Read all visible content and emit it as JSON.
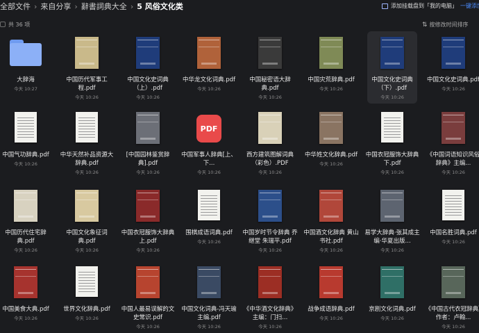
{
  "breadcrumb": {
    "items": [
      "全部文件",
      "来自分享",
      "辭書詞典大全"
    ],
    "current": "5 风俗文化类"
  },
  "promo": {
    "text": "添加挂载盘到「我的电脑」",
    "link": "一键添加",
    "icon": "drive-icon"
  },
  "toolbar": {
    "count_label": "共 36 项",
    "sort_label": "按修改时间排序",
    "sort_icon": "sort-icon"
  },
  "files": [
    {
      "name": "大辞海",
      "date": "今天 10:27",
      "kind": "folder",
      "color": "#8cb0f7"
    },
    {
      "name": "中国历代军事工程.pdf",
      "date": "今天 10:26",
      "kind": "book",
      "color": "#c9b98a"
    },
    {
      "name": "中国文化史词典（上）.pdf",
      "date": "今天 10:26",
      "kind": "book",
      "color": "#1f3c7a"
    },
    {
      "name": "中华龙文化词典.pdf",
      "date": "今天 10:26",
      "kind": "book",
      "color": "#b0623a"
    },
    {
      "name": "中国秘密语大辞典.pdf",
      "date": "今天 10:26",
      "kind": "book",
      "color": "#3a3a3a"
    },
    {
      "name": "中国灾荒辞典.pdf",
      "date": "今天 10:26",
      "kind": "book",
      "color": "#7f8a56"
    },
    {
      "name": "中国文化史词典（下）.pdf",
      "date": "今天 10:26",
      "kind": "book",
      "color": "#1f3c7a",
      "selected": true
    },
    {
      "name": "中国文化史词典.pdf",
      "date": "今天 10:26",
      "kind": "book",
      "color": "#1f3c7a"
    },
    {
      "name": "中国气功辞典.pdf",
      "date": "今天 10:26",
      "kind": "doc",
      "color": "#f2f2ee"
    },
    {
      "name": "中华天然补品资源大辞典.pdf",
      "date": "今天 10:26",
      "kind": "doc",
      "color": "#f2f2ee"
    },
    {
      "name": "[中国园林鉴赏辞典].pdf",
      "date": "今天 10:26",
      "kind": "book",
      "color": "#6c6f77"
    },
    {
      "name": "中国军事人辞典[上、下...",
      "date": "今天 10:26",
      "kind": "pdf",
      "color": "#e94a4a",
      "badge": "PDF"
    },
    {
      "name": "西方建筑图解词典（彩色）.PDF",
      "date": "今天 10:26",
      "kind": "book",
      "color": "#d9d1b8"
    },
    {
      "name": "中华姓文化辞典.pdf",
      "date": "今天 10:26",
      "kind": "book",
      "color": "#8a7462"
    },
    {
      "name": "中国衣冠服饰大辞典 下.pdf",
      "date": "今天 10:26",
      "kind": "doc",
      "color": "#f2f2ee"
    },
    {
      "name": "《中国词语知识风俗辞典》主编...",
      "date": "今天 10:26",
      "kind": "book",
      "color": "#7a3d3d"
    },
    {
      "name": "中国历代住宅辞典.pdf",
      "date": "今天 10:26",
      "kind": "book",
      "color": "#d8d2c0"
    },
    {
      "name": "中国文化象征词典.pdf",
      "date": "今天 10:26",
      "kind": "book",
      "color": "#d8c9a0"
    },
    {
      "name": "中国衣冠服饰大辞典 上.pdf",
      "date": "今天 10:26",
      "kind": "book",
      "color": "#8a2a2a"
    },
    {
      "name": "围棋成语词典.pdf",
      "date": "今天 10:26",
      "kind": "doc",
      "color": "#f2f2ee"
    },
    {
      "name": "中国岁时节令辞典 乔继堂 朱瑞平.pdf",
      "date": "今天 10:26",
      "kind": "book",
      "color": "#2c4f8a"
    },
    {
      "name": "中国酒文化辞典 黄山书社.pdf",
      "date": "今天 10:26",
      "kind": "book",
      "color": "#b1473a"
    },
    {
      "name": "易学大辞典·张其成主编·华夏出版...",
      "date": "今天 10:26",
      "kind": "book",
      "color": "#5d6470"
    },
    {
      "name": "中国名胜词典.pdf",
      "date": "今天 10:26",
      "kind": "doc",
      "color": "#f2f2ee"
    },
    {
      "name": "中国美食大典.pdf",
      "date": "今天 10:26",
      "kind": "book",
      "color": "#a6332e"
    },
    {
      "name": "世界文化辞典.pdf",
      "date": "今天 10:26",
      "kind": "doc",
      "color": "#f2f2ee"
    },
    {
      "name": "中国人最易误解的文史常识.pdf",
      "date": "今天 10:26",
      "kind": "book",
      "color": "#b7442f"
    },
    {
      "name": "中国文化词典-冯天瑜主编.pdf",
      "date": "今天 10:26",
      "kind": "book",
      "color": "#3a4a63"
    },
    {
      "name": "《中华酒文化辞典》主编：门扫...",
      "date": "今天 10:26",
      "kind": "book",
      "color": "#9c2e24"
    },
    {
      "name": "战争成语辞典.pdf",
      "date": "今天 10:26",
      "kind": "book",
      "color": "#b83a2f"
    },
    {
      "name": "京剧文化词典.pdf",
      "date": "今天 10:26",
      "kind": "book",
      "color": "#2f6f66"
    },
    {
      "name": "《中国古代衣冠辞典》作者：卢翰...",
      "date": "今天 10:26",
      "kind": "book",
      "color": "#58665a"
    }
  ]
}
